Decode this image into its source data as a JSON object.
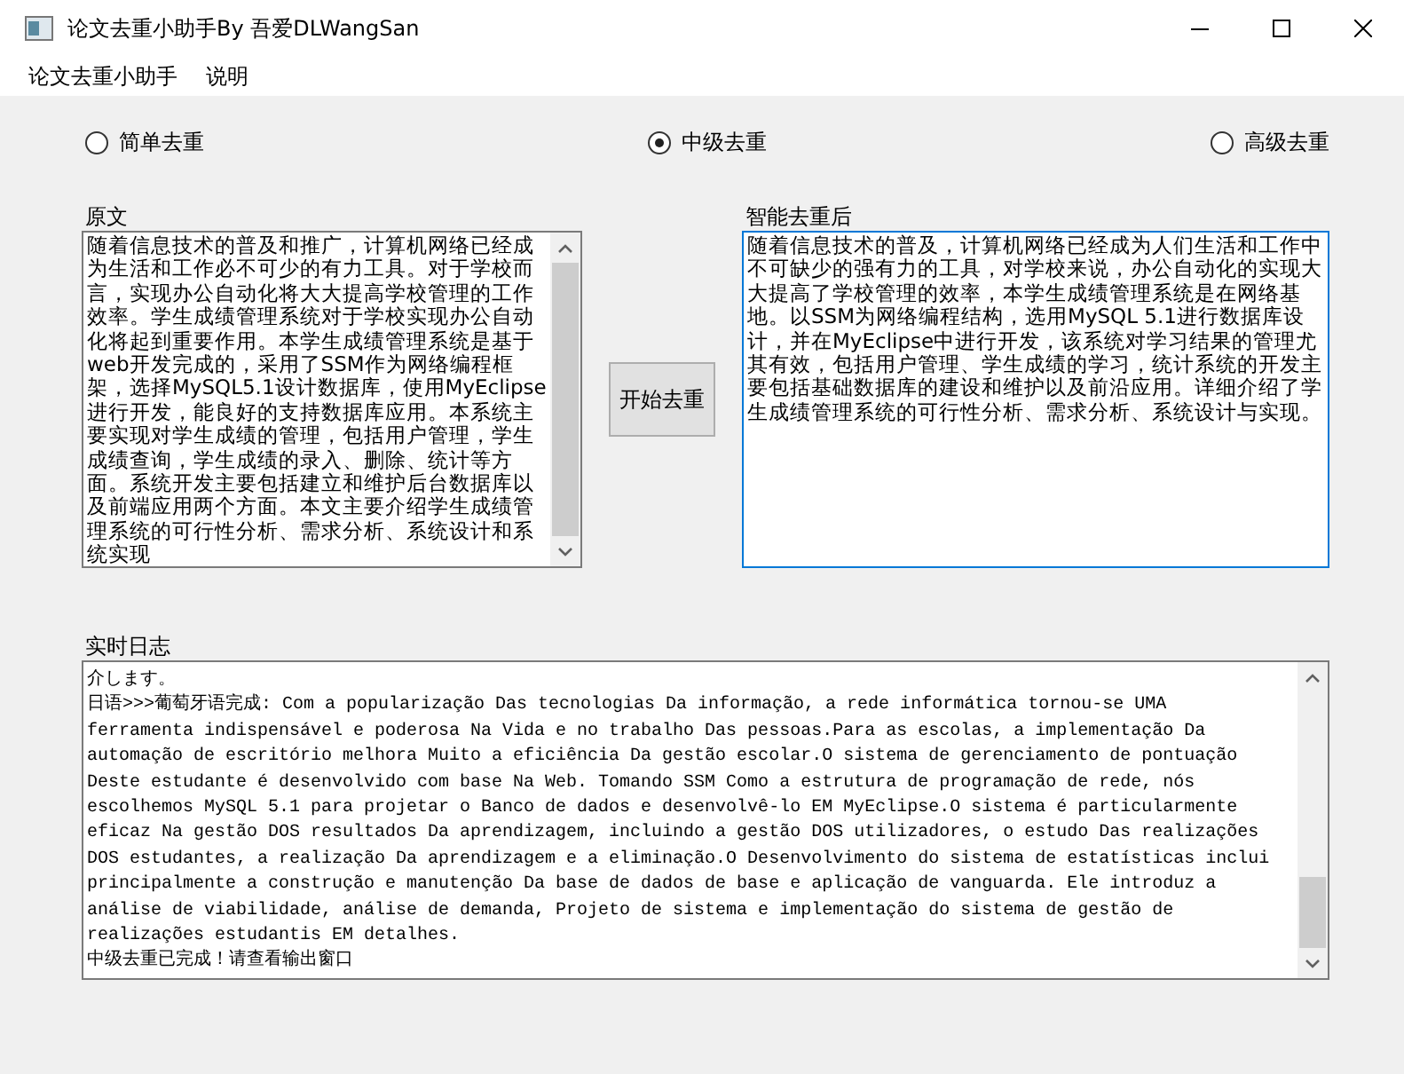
{
  "window": {
    "title": "论文去重小助手By 吾爱DLWangSan"
  },
  "menu": [
    "论文去重小助手",
    "说明"
  ],
  "modes": [
    {
      "label": "简单去重",
      "selected": false
    },
    {
      "label": "中级去重",
      "selected": true
    },
    {
      "label": "高级去重",
      "selected": false
    }
  ],
  "original": {
    "label": "原文",
    "text": "随着信息技术的普及和推广，计算机网络已经成为生活和工作必不可少的有力工具。对于学校而言，实现办公自动化将大大提高学校管理的工作效率。学生成绩管理系统对于学校实现办公自动化将起到重要作用。本学生成绩管理系统是基于web开发完成的，采用了SSM作为网络编程框架，选择MySQL5.1设计数据库，使用MyEclipse进行开发，能良好的支持数据库应用。本系统主要实现对学生成绩的管理，包括用户管理，学生成绩查询，学生成绩的录入、删除、统计等方面。系统开发主要包括建立和维护后台数据库以及前端应用两个方面。本文主要介绍学生成绩管理系统的可行性分析、需求分析、系统设计和系统实现"
  },
  "start_button": "开始去重",
  "result": {
    "label": "智能去重后",
    "text": "随着信息技术的普及，计算机网络已经成为人们生活和工作中不可缺少的强有力的工具，对学校来说，办公自动化的实现大大提高了学校管理的效率，本学生成绩管理系统是在网络基地。以SSM为网络编程结构，选用MySQL 5.1进行数据库设计，并在MyEclipse中进行开发，该系统对学习结果的管理尤其有效，包括用户管理、学生成绩的学习，统计系统的开发主要包括基础数据库的建设和维护以及前沿应用。详细介绍了学生成绩管理系统的可行性分析、需求分析、系统设计与实现。"
  },
  "log": {
    "label": "实时日志",
    "lines": [
      "介します。",
      "日语>>>葡萄牙语完成: Com a popularização Das tecnologias Da informação, a rede informática tornou-se UMA",
      "ferramenta indispensável e poderosa Na Vida e no trabalho Das pessoas.Para as escolas, a implementação Da",
      "automação de escritório melhora Muito a eficiência Da gestão escolar.O sistema de gerenciamento de pontuação",
      "Deste estudante é desenvolvido com base Na Web. Tomando SSM Como a estrutura de programação de rede, nós",
      "escolhemos MySQL 5.1 para projetar o Banco de dados e desenvolvê-lo EM MyEclipse.O sistema é particularmente",
      "eficaz Na gestão DOS resultados Da aprendizagem, incluindo a gestão DOS utilizadores, o estudo Das realizações",
      "DOS estudantes, a realização Da aprendizagem e a eliminação.O Desenvolvimento do sistema de estatísticas inclui",
      "principalmente a construção e manutenção Da base de dados de base e aplicação de vanguarda. Ele introduz a",
      "análise de viabilidade, análise de demanda, Projeto de sistema e implementação do sistema de gestão de",
      "realizações estudantis EM detalhes.",
      "中级去重已完成！请查看输出窗口"
    ]
  }
}
